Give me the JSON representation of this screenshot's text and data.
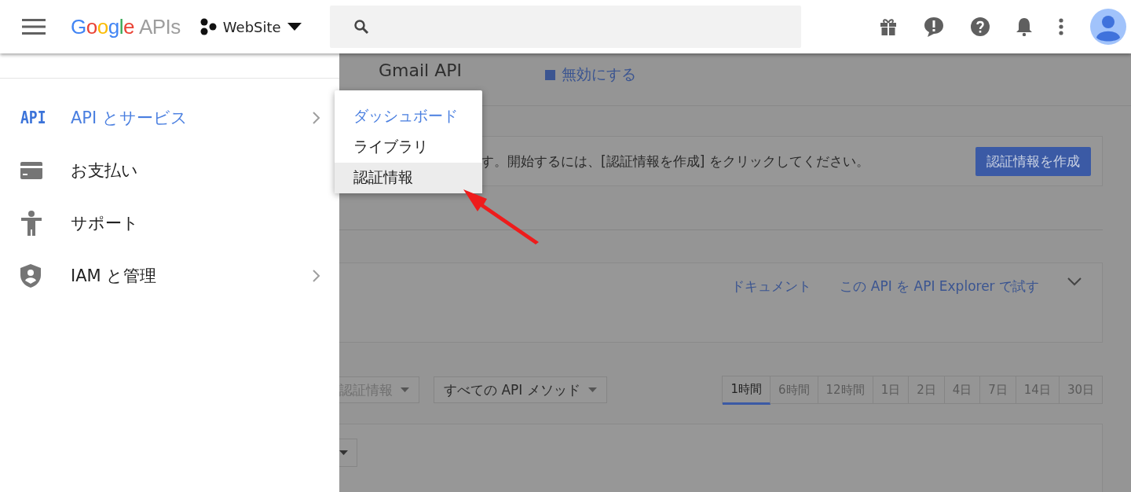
{
  "header": {
    "logo": {
      "brand": "Google",
      "product": "APIs"
    },
    "project": "WebSite"
  },
  "sidebar": {
    "items": [
      {
        "badge": "API",
        "label": "API とサービス",
        "selected": true,
        "has_submenu": true
      },
      {
        "label": "お支払い",
        "selected": false,
        "has_submenu": false
      },
      {
        "label": "サポート",
        "selected": false,
        "has_submenu": false
      },
      {
        "label": "IAM と管理",
        "selected": false,
        "has_submenu": true
      }
    ]
  },
  "submenu": {
    "items": [
      {
        "label": "ダッシュボード",
        "selected": true,
        "hovered": false
      },
      {
        "label": "ライブラリ",
        "selected": false,
        "hovered": false
      },
      {
        "label": "認証情報",
        "selected": false,
        "hovered": true
      }
    ]
  },
  "main": {
    "title": "Gmail API",
    "disable_link": "無効にする",
    "banner": {
      "text": "す。開始するには、[認証情報を作成] をクリックしてください。",
      "button": "認証情報を作成"
    },
    "links": [
      "ドキュメント",
      "この API を API Explorer で試す"
    ],
    "filters": [
      "認証情報",
      "すべての API メソッド"
    ],
    "time_ranges": [
      {
        "label": "1時間",
        "selected": true
      },
      {
        "label": "6時間",
        "selected": false
      },
      {
        "label": "12時間",
        "selected": false
      },
      {
        "label": "1日",
        "selected": false
      },
      {
        "label": "2日",
        "selected": false
      },
      {
        "label": "4日",
        "selected": false
      },
      {
        "label": "7日",
        "selected": false
      },
      {
        "label": "14日",
        "selected": false
      },
      {
        "label": "30日",
        "selected": false
      }
    ]
  }
}
